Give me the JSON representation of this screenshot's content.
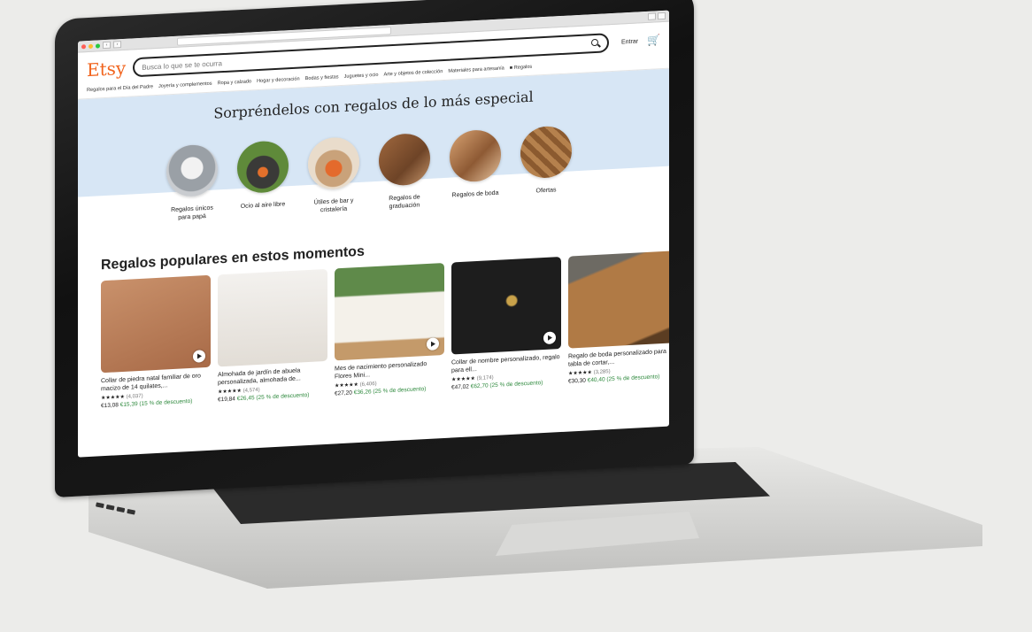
{
  "header": {
    "logo": "Etsy",
    "search_placeholder": "Busca lo que se te ocurra",
    "signin": "Entrar",
    "icons": [
      "search-icon",
      "cart-icon"
    ]
  },
  "nav": {
    "items": [
      "Regalos para el Día del Padre",
      "Joyería y complementos",
      "Ropa y calzado",
      "Hogar y decoración",
      "Bodas y fiestas",
      "Juguetes y ocio",
      "Arte y objetos de colección",
      "Materiales para artesanía",
      "Regalos"
    ]
  },
  "hero": {
    "title": "Sorpréndelos con regalos de lo más especial",
    "bg_color": "#d7e6f5",
    "categories": [
      {
        "label": "Regalos únicos para papá"
      },
      {
        "label": "Ocio al aire libre"
      },
      {
        "label": "Útiles de bar y cristalería"
      },
      {
        "label": "Regalos de graduación"
      },
      {
        "label": "Regalos de boda"
      },
      {
        "label": "Ofertas"
      }
    ]
  },
  "popular": {
    "title": "Regalos populares en estos momentos",
    "products": [
      {
        "title": "Collar de piedra natal familiar de oro macizo de 14 quilates,...",
        "stars": "★★★★★",
        "count": "(4,037)",
        "price": "€13,08",
        "sale": "€15,39 (15 % de descuento)"
      },
      {
        "title": "Almohada de jardín de abuela personalizada, almohada de...",
        "stars": "★★★★★",
        "count": "(4,574)",
        "price": "€19,84",
        "sale": "€26,45 (25 % de descuento)"
      },
      {
        "title": "Mes de nacimiento personalizado Flores Mini...",
        "stars": "★★★★★",
        "count": "(6,406)",
        "price": "€27,20",
        "sale": "€36,26 (25 % de descuento)"
      },
      {
        "title": "Collar de nombre personalizado, regalo para ell...",
        "stars": "★★★★★",
        "count": "(9,174)",
        "price": "€47,02",
        "sale": "€62,70 (25 % de descuento)"
      },
      {
        "title": "Regalo de boda personalizado para tabla de cortar,...",
        "stars": "★★★★★",
        "count": "(3,285)",
        "price": "€30,30",
        "sale": "€40,40 (25 % de descuento)"
      }
    ]
  },
  "colors": {
    "accent": "#f1641e",
    "sale_green": "#2f8a3e"
  }
}
